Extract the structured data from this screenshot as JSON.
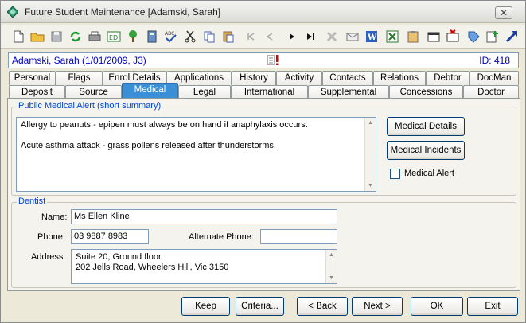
{
  "window": {
    "title": "Future Student Maintenance  [Adamski, Sarah]",
    "close_label": "✕"
  },
  "toolbar": {
    "icons": [
      "new-document-icon",
      "open-folder-icon",
      "save-icon",
      "refresh-icon",
      "print-icon",
      "edit-id-icon",
      "family-tree-icon",
      "calculator-icon",
      "spell-check-icon",
      "cut-icon",
      "copy-icon",
      "paste-icon",
      "first-record-icon",
      "previous-record-icon",
      "next-record-icon",
      "last-record-icon",
      "delete-icon",
      "email-icon",
      "word-icon",
      "excel-icon",
      "clipboard-icon",
      "calendar-icon",
      "calendar-delete-icon",
      "tag-icon",
      "notes-icon",
      "arrow-icon"
    ]
  },
  "student": {
    "name": "Adamski, Sarah (1/01/2009, J3)",
    "id_label": "ID: 418"
  },
  "tabs_row1": [
    "Personal",
    "Flags",
    "Enrol Details",
    "Applications",
    "History",
    "Activity",
    "Contacts",
    "Relations",
    "Debtor",
    "DocMan"
  ],
  "tabs_row2": [
    "Deposit",
    "Source",
    "Medical",
    "Legal",
    "International",
    "Supplemental",
    "Concessions",
    "Doctor"
  ],
  "active_tab": "Medical",
  "medical_alert": {
    "legend": "Public Medical Alert (short summary)",
    "line1": "Allergy to peanuts - epipen must always be on hand if anaphylaxis occurs.",
    "line2": "Acute asthma attack - grass pollens released after thunderstorms.",
    "details_button": "Medical Details",
    "incidents_button": "Medical Incidents",
    "checkbox_label": "Medical Alert",
    "checkbox_checked": false
  },
  "dentist": {
    "legend": "Dentist",
    "name_label": "Name:",
    "name_value": "Ms Ellen Kline",
    "phone_label": "Phone:",
    "phone_value": "03 9887 8983",
    "alt_phone_label": "Alternate Phone:",
    "alt_phone_value": "",
    "address_label": "Address:",
    "address_line1": "Suite 20, Ground floor",
    "address_line2": "202 Jells Road, Wheelers Hill, Vic 3150"
  },
  "footer": {
    "keep": "Keep",
    "criteria": "Criteria...",
    "back": "< Back",
    "next": "Next >",
    "ok": "OK",
    "exit": "Exit"
  }
}
